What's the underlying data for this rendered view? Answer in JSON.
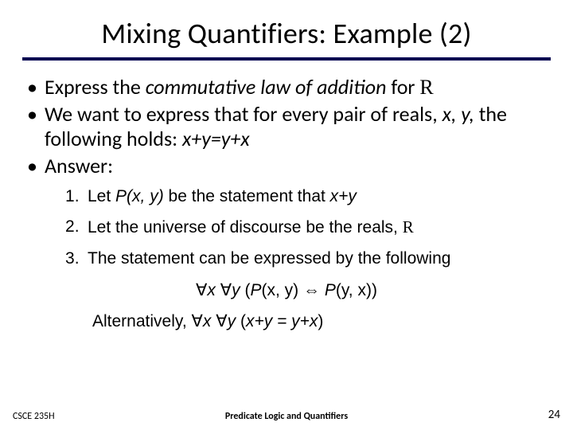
{
  "title": "Mixing Quantifiers: Example (2)",
  "bullets": {
    "b1_pre": "Express the ",
    "b1_em": "commutative law of addition",
    "b1_post": " for ",
    "b1_r": "R",
    "b2_pre": "We want to express that for every pair of reals, ",
    "b2_xy": "x, y,",
    "b2_mid": " the following holds: ",
    "b2_eq": "x+y=y+x",
    "b3": "Answer:"
  },
  "sub": {
    "s1_pre": "Let ",
    "s1_p": "P",
    "s1_args": "(x, y)",
    "s1_mid": " be the statement that ",
    "s1_expr": "x+y",
    "s2_pre": "Let the universe of discourse be the reals, ",
    "s2_r": "R",
    "s3": "The statement can be expressed by the following"
  },
  "formula": {
    "fa": "∀",
    "x": "x ",
    "y": "y ",
    "open": "(",
    "p": "P",
    "args1": "(x, y)",
    "iff": " ⇔ ",
    "args2": "(y, x",
    "close": "))"
  },
  "alt": {
    "word": "Alternatively, ",
    "fa": "∀",
    "x": "x ",
    "y": "y ",
    "open": "(",
    "eq": "x+y = y+x",
    "close": ")"
  },
  "footer": {
    "left": "CSCE 235H",
    "center": "Predicate Logic and Quantifiers",
    "right": "24"
  }
}
